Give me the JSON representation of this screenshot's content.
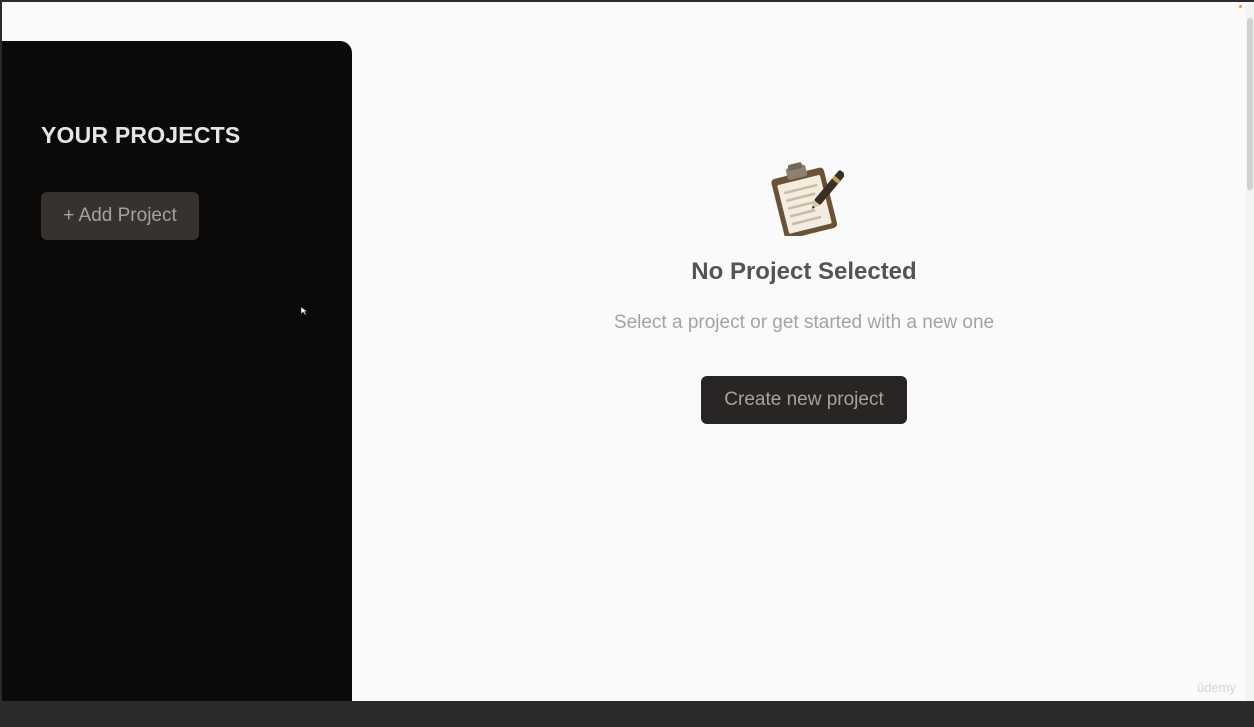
{
  "sidebar": {
    "title": "YOUR PROJECTS",
    "add_button_label": "+ Add Project"
  },
  "main": {
    "icon": "clipboard-icon",
    "title": "No Project Selected",
    "subtitle": "Select a project or get started with a new one",
    "create_button_label": "Create new project"
  },
  "watermark": "ûdemy",
  "colors": {
    "sidebar_bg": "#0c0a09",
    "page_bg": "#fafafa",
    "button_bg": "#292524",
    "title_text": "#57534e",
    "muted_text": "#a8a29e"
  }
}
